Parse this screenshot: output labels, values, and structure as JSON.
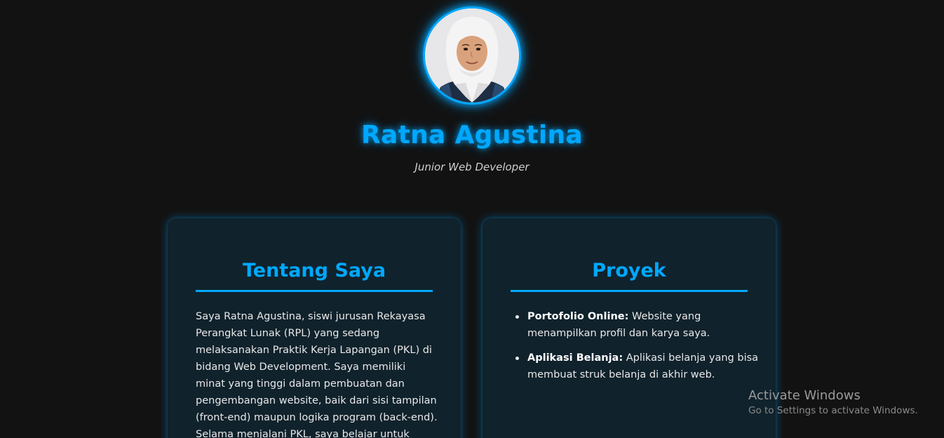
{
  "profile": {
    "name": "Ratna Agustina",
    "role": "Junior Web Developer",
    "accent": "#00a8ff"
  },
  "about": {
    "title": "Tentang Saya",
    "text": "Saya Ratna Agustina, siswi jurusan Rekayasa Perangkat Lunak (RPL) yang sedang melaksanakan Praktik Kerja Lapangan (PKL) di bidang Web Development. Saya memiliki minat yang tinggi dalam pembuatan dan pengembangan website, baik dari sisi tampilan (front-end) maupun logika program (back-end). Selama menjalani PKL, saya belajar untuk"
  },
  "projects": {
    "title": "Proyek",
    "items": [
      {
        "name": "Portofolio Online:",
        "desc": " Website yang menampilkan profil dan karya saya."
      },
      {
        "name": "Aplikasi Belanja:",
        "desc": " Aplikasi belanja yang bisa membuat struk belanja di akhir web."
      }
    ]
  },
  "watermark": {
    "title": "Activate Windows",
    "subtitle": "Go to Settings to activate Windows."
  }
}
